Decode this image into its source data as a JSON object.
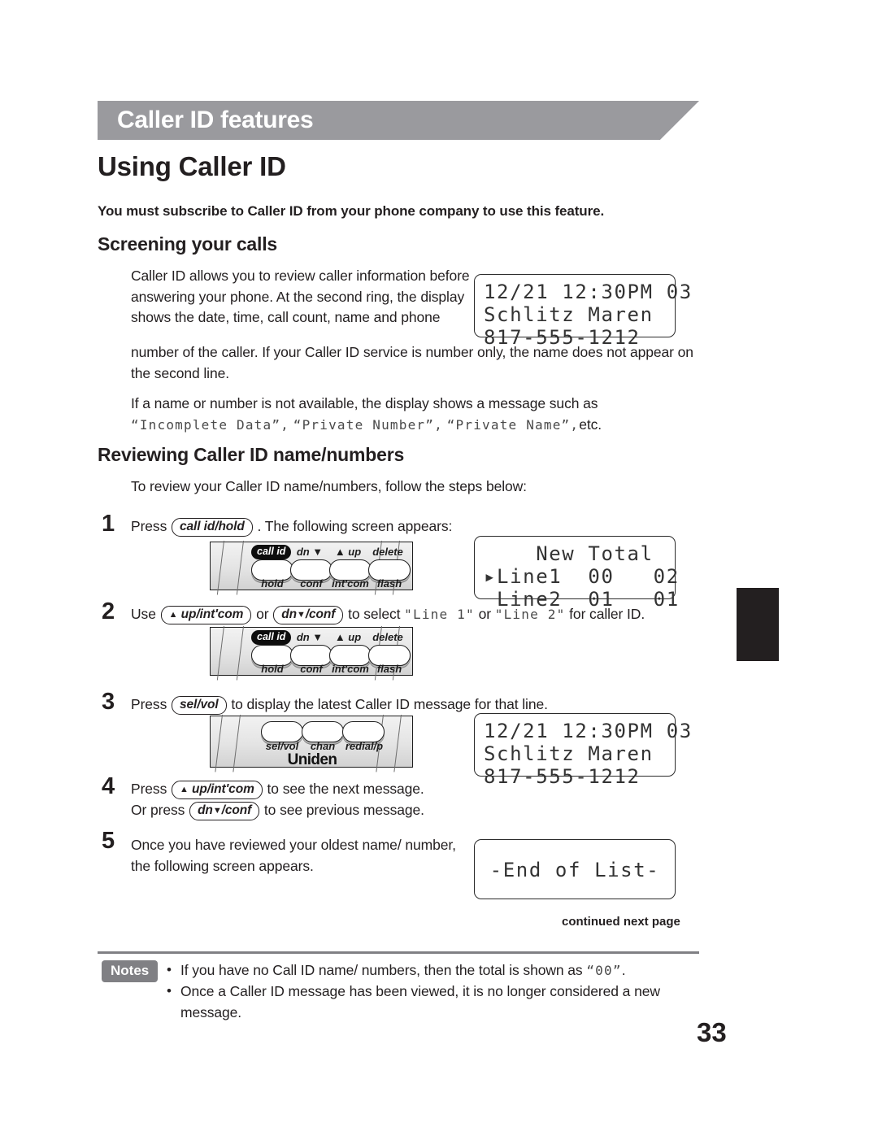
{
  "chapter": {
    "banner_title": "Caller ID features",
    "banner_color": "#9a9a9e"
  },
  "headings": {
    "h1": "Using Caller ID",
    "subscribe_note": "You must subscribe to Caller ID from your phone company to use this feature.",
    "screening": "Screening your calls",
    "reviewing": "Reviewing Caller ID name/numbers"
  },
  "screening": {
    "para_narrow": "Caller ID allows you to review caller information before answering your phone. At the second ring, the display shows the date, time, call count, name and phone",
    "para_wide": "number of the caller. If your Caller ID service is number only, the name does not appear on the second line.",
    "para_avail_pre": "If a name or number is not available, the display shows a message such as",
    "avail_q1": "“Incomplete Data”,",
    "avail_q2": "“Private Number”,",
    "avail_q3": "“Private Name”,",
    "avail_tail": "etc."
  },
  "reviewing": {
    "intro": "To review your Caller ID name/numbers, follow the steps below:"
  },
  "steps": [
    {
      "number": "1",
      "pre": "Press",
      "key": "call id/hold",
      "post": ". The following screen appears:"
    },
    {
      "number": "2",
      "pre": "Use",
      "key1": "up/int'com",
      "mid1": "or",
      "key2": "dn",
      "key2b": "/conf",
      "mid2": "to select",
      "lcd1": "\"Line 1\"",
      "mid3": "or",
      "lcd2": "\"Line 2\"",
      "post": "for caller ID."
    },
    {
      "number": "3",
      "pre": "Press",
      "key": "sel/vol",
      "post": "to display the latest Caller ID message for that line."
    },
    {
      "number": "4",
      "line1_pre": "Press",
      "line1_key": "up/int'com",
      "line1_post": "to see the next message.",
      "line2_pre": "Or press",
      "line2_key": "dn",
      "line2_keyb": "/conf",
      "line2_post": "to see previous message."
    },
    {
      "number": "5",
      "text": "Once you have reviewed your oldest name/ number, the following screen appears."
    }
  ],
  "lcd_screens": {
    "caller_id": {
      "line1": "12/21 12:30PM 03",
      "line2": "Schlitz Maren",
      "line3": "817-555-1212"
    },
    "line_totals": {
      "line1": "    New Total",
      "line2": "▸Line1  00   02",
      "line3": " Line2  01   01"
    },
    "end_of_list": {
      "line1": "-End of List-"
    }
  },
  "keypads": {
    "row_a": {
      "pill": "call id",
      "top_labels": [
        "",
        "dn ▼",
        "▲ up",
        "delete"
      ],
      "bottom_labels": [
        "hold",
        "conf",
        "int'com",
        "flash"
      ]
    },
    "row_b": {
      "bottom_labels": [
        "sel/vol",
        "chan",
        "redial/p"
      ],
      "brand": "Uniden"
    }
  },
  "footer": {
    "continued": "continued next page",
    "notes_label": "Notes",
    "notes": [
      {
        "pre": "If you have no Call ID name/ numbers, then the total is shown as",
        "lcd": "“00”",
        "post": "."
      },
      {
        "pre": "Once a Caller ID message has been viewed, it is no longer considered a new message.",
        "lcd": "",
        "post": ""
      }
    ],
    "page_number": "33"
  }
}
